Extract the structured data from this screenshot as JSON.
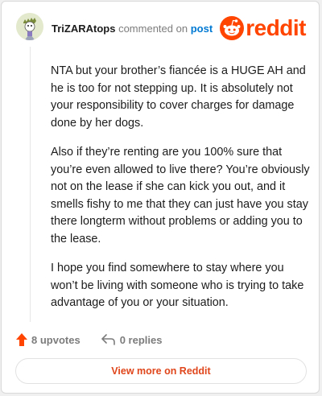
{
  "header": {
    "username": "TriZARAtops",
    "action_text": "commented on",
    "post_link": "post",
    "logo_text": "reddit"
  },
  "comment": {
    "paragraphs": [
      "NTA but your brother’s fiancée is a HUGE AH and he is too for not stepping up. It is absolutely not your responsibility to cover charges for damage done by her dogs.",
      "Also if they’re renting are you 100% sure that you’re even allowed to live there? You’re obviously not on the lease if she can kick you out, and it smells fishy to me that they can just have you stay there longterm without problems or adding you to the lease.",
      "I hope you find somewhere to stay where you won’t be living with someone who is trying to take advantage of you or your situation."
    ]
  },
  "actions": {
    "upvotes_label": "8 upvotes",
    "replies_label": "0 replies"
  },
  "footer": {
    "view_more_label": "View more on Reddit"
  },
  "colors": {
    "brand": "#ff4500",
    "link": "#0079d3",
    "muted": "#7c7c7c"
  },
  "icons": {
    "avatar": "avatar",
    "logo": "reddit-snoo-icon",
    "upvote": "upvote-arrow-icon",
    "reply": "reply-arrow-icon"
  }
}
